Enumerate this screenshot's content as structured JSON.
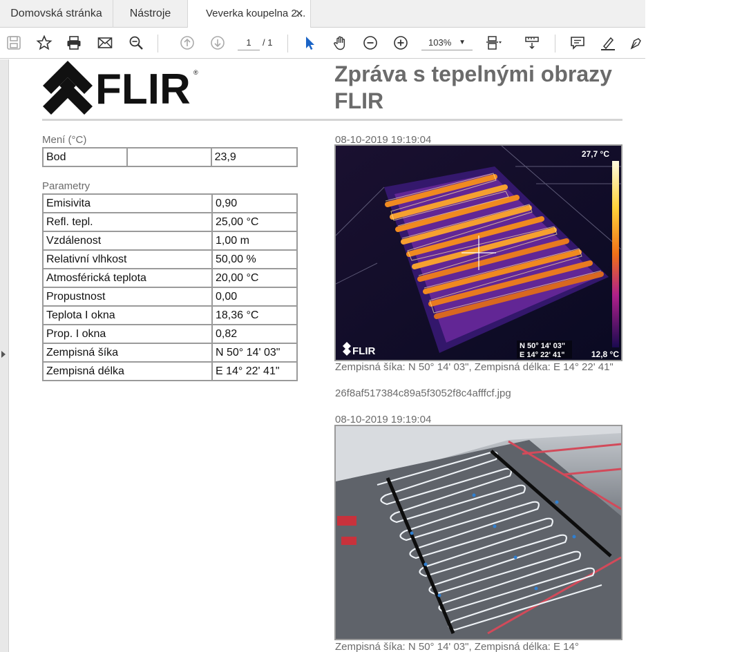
{
  "tabs": {
    "home": "Domovská stránka",
    "tools": "Nástroje",
    "document": "Veverka koupelna 2...",
    "close": "×"
  },
  "toolbar": {
    "page_current": "1",
    "page_total": "/ 1",
    "zoom": "103%",
    "icons": [
      "save-icon",
      "star-icon",
      "print-icon",
      "mail-icon",
      "search-icon",
      "page-up-icon",
      "page-down-icon",
      "select-cursor-icon",
      "hand-icon",
      "zoom-out-icon",
      "zoom-in-icon",
      "fit-page-icon",
      "measure-icon",
      "comment-icon",
      "highlight-icon",
      "sign-icon"
    ]
  },
  "report": {
    "title": "Zpráva s tepelnými obrazy FLIR",
    "logo_text": "FLIR",
    "measure_heading": "Mení (°C)",
    "measure_rows": [
      {
        "label": "Bod",
        "mid": "",
        "value": "23,9"
      }
    ],
    "params_heading": "Parametry",
    "params_rows": [
      {
        "label": "Emisivita",
        "value": "0,90"
      },
      {
        "label": "Refl. tepl.",
        "value": "25,00 °C"
      },
      {
        "label": "Vzdálenost",
        "value": "1,00 m"
      },
      {
        "label": "Relativní vlhkost",
        "value": "50,00 %"
      },
      {
        "label": "Atmosférická teplota",
        "value": "20,00 °C"
      },
      {
        "label": "Propustnost",
        "value": "0,00"
      },
      {
        "label": "Teplota I okna",
        "value": "18,36 °C"
      },
      {
        "label": "Prop. I okna",
        "value": "0,82"
      },
      {
        "label": "Zempisná šíka",
        "value": "N 50° 14' 03\""
      },
      {
        "label": "Zempisná délka",
        "value": "E 14° 22' 41\""
      }
    ],
    "image1": {
      "timestamp": "08-10-2019 19:19:04",
      "max_temp": "27,7 °C",
      "min_temp": "12,8 °C",
      "gps_lat": "N 50° 14' 03\"",
      "gps_lon": "E 14° 22' 41\"",
      "caption": "Zempisná šíka: N 50° 14' 03\", Zempisná délka: E 14° 22' 41\"",
      "filename": "26f8af517384c89a5f3052f8c4afffcf.jpg"
    },
    "image2": {
      "timestamp": "08-10-2019 19:19:04",
      "caption": "Zempisná šíka: N 50° 14' 03\", Zempisná délka: E 14°"
    }
  }
}
